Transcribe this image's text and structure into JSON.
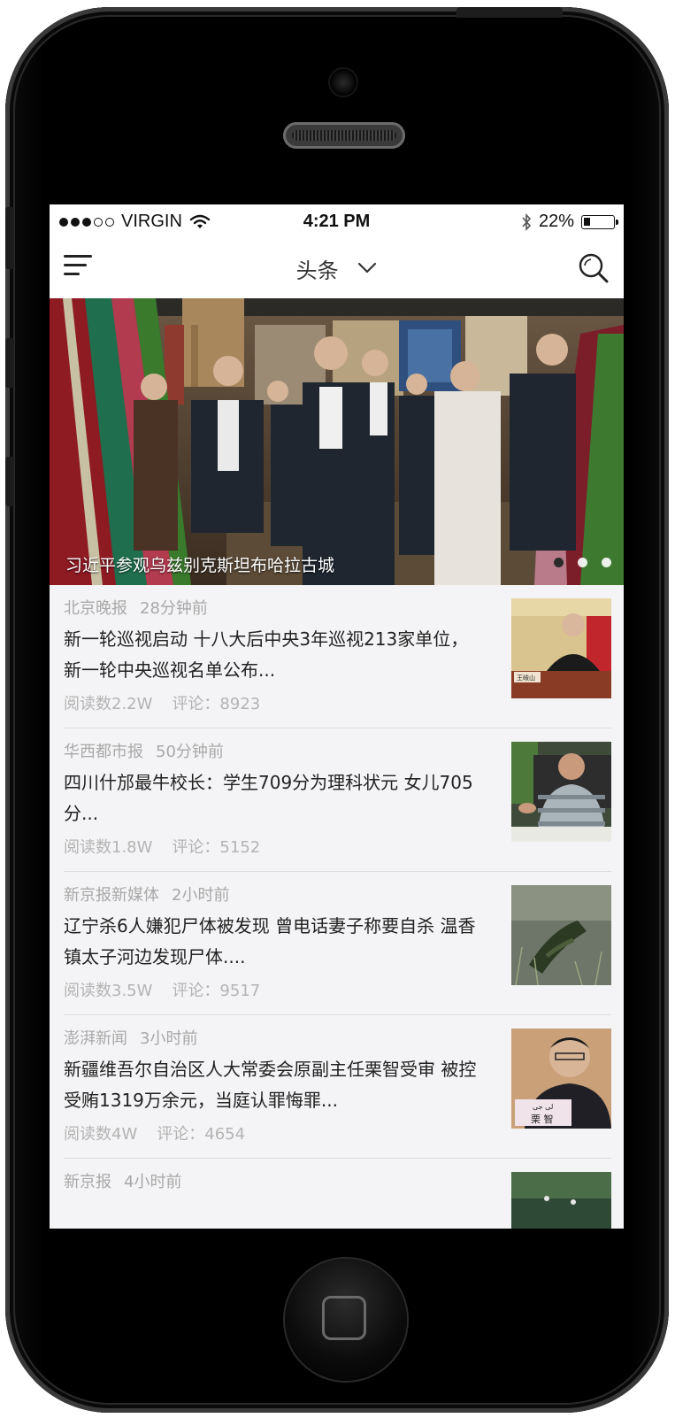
{
  "status_bar": {
    "carrier": "VIRGIN",
    "time": "4:21 PM",
    "battery": "22%",
    "battery_level": 0.22,
    "signal_dots_filled": 3,
    "signal_dots_total": 5,
    "icons": [
      "wifi-icon",
      "bluetooth-icon",
      "battery-icon"
    ]
  },
  "nav": {
    "title": "头条",
    "icons": [
      "menu-icon",
      "chevron-down-icon",
      "search-icon"
    ]
  },
  "banner": {
    "caption": "习近平参观乌兹别克斯坦布哈拉古城",
    "slide_count": 3,
    "active_slide": 1
  },
  "news": [
    {
      "source": "北京晚报",
      "time": "28分钟前",
      "title": "新一轮巡视启动 十八大后中央3年巡视213家单位，新一轮中央巡视名单公布...",
      "reads": "阅读数2.2W",
      "comments": "评论：8923"
    },
    {
      "source": "华西都市报",
      "time": "50分钟前",
      "title": "四川什邡最牛校长：学生709分为理科状元 女儿705分...",
      "reads": "阅读数1.8W",
      "comments": "评论：5152"
    },
    {
      "source": "新京报新媒体",
      "time": "2小时前",
      "title": "辽宁杀6人嫌犯尸体被发现 曾电话妻子称要自杀 温香镇太子河边发现尸体....",
      "reads": "阅读数3.5W",
      "comments": "评论：9517"
    },
    {
      "source": "澎湃新闻",
      "time": "3小时前",
      "title": "新疆维吾尔自治区人大常委会原副主任栗智受审 被控受贿1319万余元，当庭认罪悔罪...",
      "reads": "阅读数4W",
      "comments": "评论：4654"
    },
    {
      "source": "新京报",
      "time": "4小时前",
      "title": "",
      "reads": "",
      "comments": ""
    }
  ],
  "thumb_labels": {
    "t1_sign": "王岐山",
    "t4_sign_top": "لى جى",
    "t4_sign_name": "栗 智"
  },
  "colors": {
    "screen_bg": "#f4f4f6",
    "meta_text": "#a8a8a8",
    "title_text": "#222222"
  }
}
